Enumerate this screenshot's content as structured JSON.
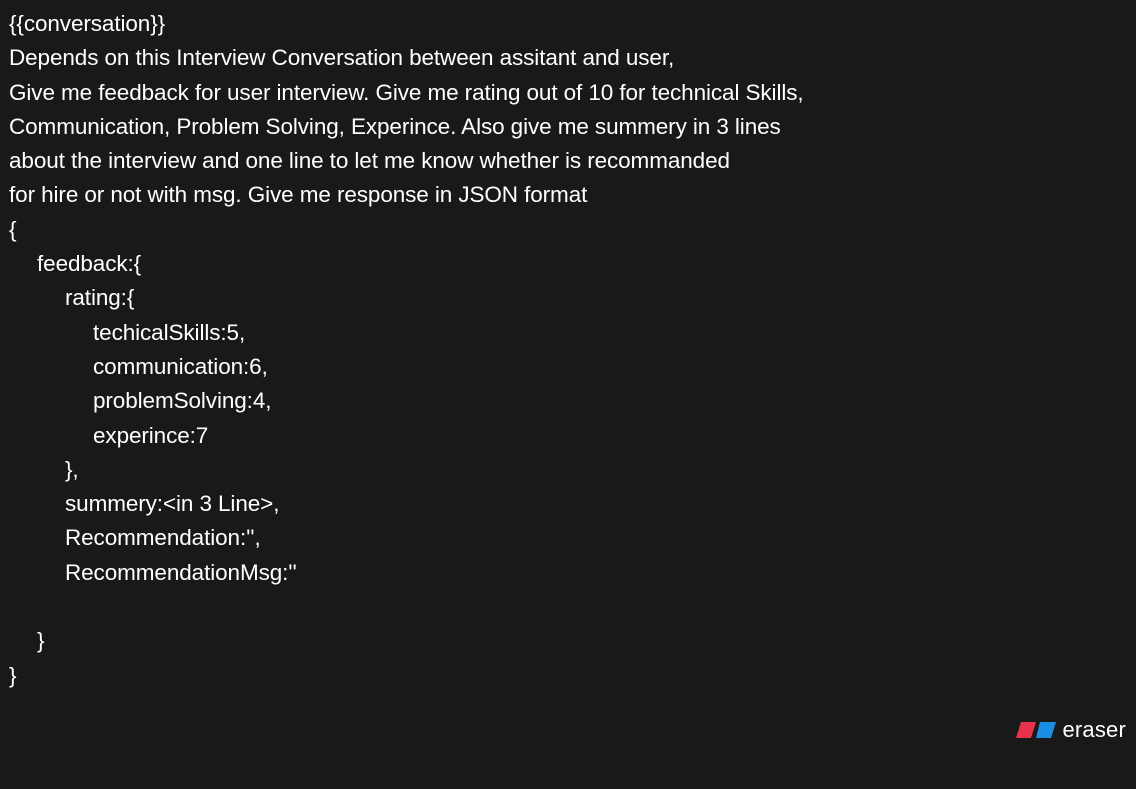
{
  "document": {
    "lines": [
      {
        "text": "{{conversation}}",
        "indent": 0
      },
      {
        "text": "Depends on this Interview Conversation between assitant and user,",
        "indent": 0
      },
      {
        "text": "Give me feedback for user interview. Give me rating out of 10 for technical Skills,",
        "indent": 0
      },
      {
        "text": "Communication, Problem Solving, Experince. Also give me summery in 3 lines",
        "indent": 0
      },
      {
        "text": "about the interview and one line to let me know whether is recommanded",
        "indent": 0
      },
      {
        "text": "for hire or not with msg. Give me response in JSON format",
        "indent": 0
      },
      {
        "text": "{",
        "indent": 0
      },
      {
        "text": "feedback:{",
        "indent": 1
      },
      {
        "text": "rating:{",
        "indent": 2
      },
      {
        "text": "techicalSkills:5,",
        "indent": 3
      },
      {
        "text": "communication:6,",
        "indent": 3
      },
      {
        "text": "problemSolving:4,",
        "indent": 3
      },
      {
        "text": "experince:7",
        "indent": 3
      },
      {
        "text": "},",
        "indent": 2
      },
      {
        "text": "summery:<in 3 Line>,",
        "indent": 2
      },
      {
        "text": "Recommendation:'',",
        "indent": 2
      },
      {
        "text": "RecommendationMsg:''",
        "indent": 2
      },
      {
        "text": "",
        "indent": 0
      },
      {
        "text": "}",
        "indent": 1
      },
      {
        "text": "}",
        "indent": 0
      }
    ]
  },
  "branding": {
    "name": "eraser",
    "logo_icon": "eraser-logo-icon",
    "colors": {
      "logo_red": "#e8334a",
      "logo_blue": "#1a8fe3"
    }
  },
  "theme": {
    "background": "#191919",
    "text": "#ffffff"
  }
}
